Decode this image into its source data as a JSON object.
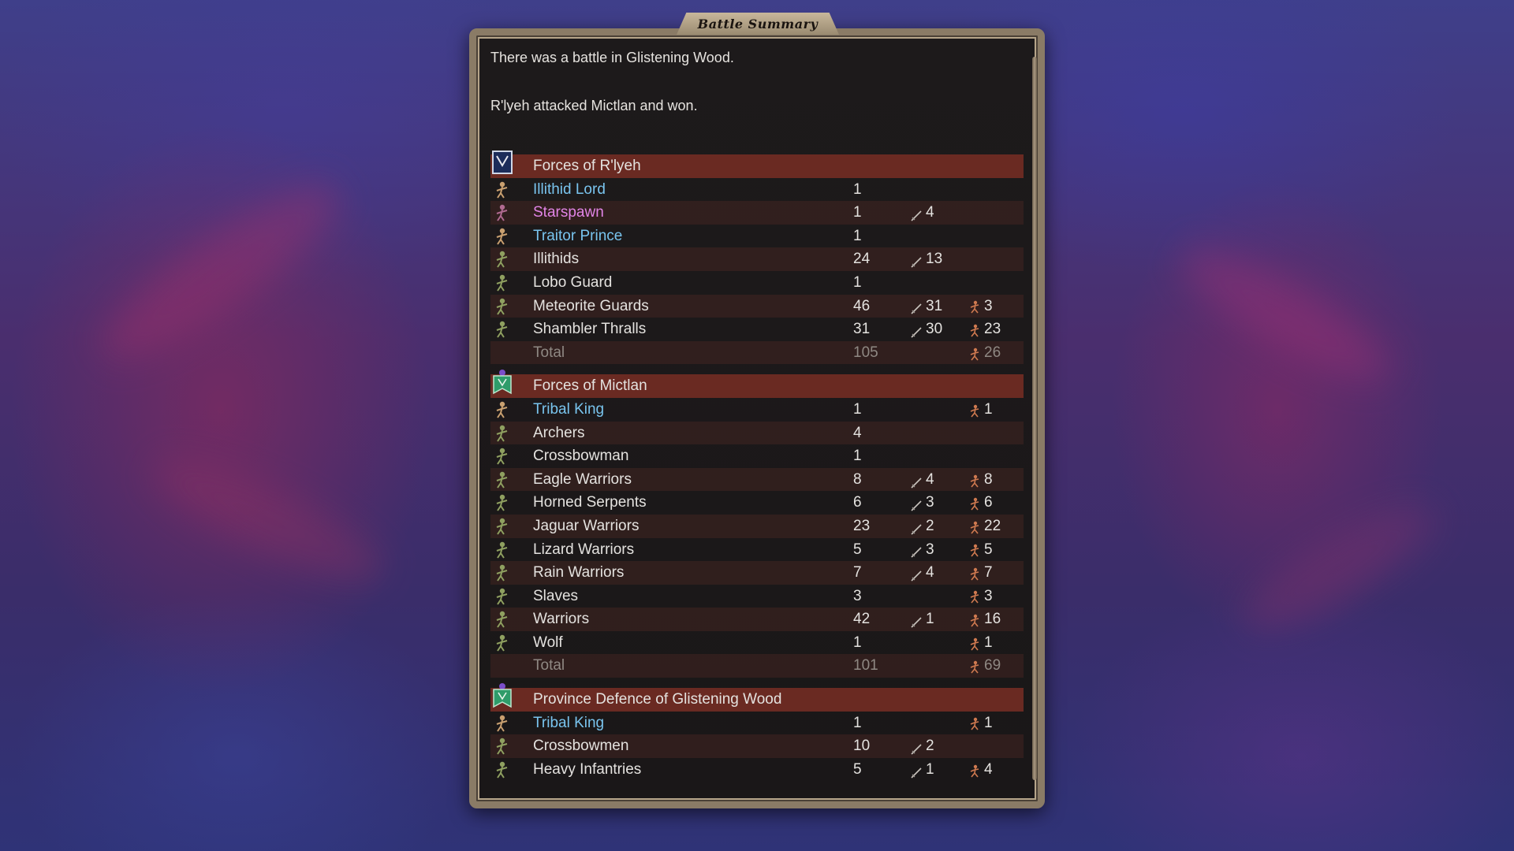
{
  "window": {
    "title": "Battle Summary"
  },
  "intro": {
    "line1": "There was a battle in Glistening Wood.",
    "line2": "R'lyeh attacked Mictlan and won."
  },
  "colors": {
    "commander": "#79c4ee",
    "magic_unit": "#e184e6",
    "header_bar": "#6a2a22",
    "alt_row": "#4b2823",
    "panel_frame": "#8a7b66"
  },
  "sections": [
    {
      "title": "Forces of R'lyeh",
      "banner_icon": "rlyeh-banner-icon",
      "rows": [
        {
          "name": "Illithid Lord",
          "type": "commander",
          "icon": "illithid-lord-icon",
          "count": "1",
          "kills": "",
          "losses": ""
        },
        {
          "name": "Starspawn",
          "type": "magic",
          "icon": "starspawn-icon",
          "count": "1",
          "kills": "4",
          "losses": ""
        },
        {
          "name": "Traitor Prince",
          "type": "commander",
          "icon": "traitor-prince-icon",
          "count": "1",
          "kills": "",
          "losses": ""
        },
        {
          "name": "Illithids",
          "type": "unit",
          "icon": "illithids-icon",
          "count": "24",
          "kills": "13",
          "losses": ""
        },
        {
          "name": "Lobo Guard",
          "type": "unit",
          "icon": "lobo-guard-icon",
          "count": "1",
          "kills": "",
          "losses": ""
        },
        {
          "name": "Meteorite Guards",
          "type": "unit",
          "icon": "meteorite-guards-icon",
          "count": "46",
          "kills": "31",
          "losses": "3"
        },
        {
          "name": "Shambler Thralls",
          "type": "unit",
          "icon": "shambler-thralls-icon",
          "count": "31",
          "kills": "30",
          "losses": "23"
        },
        {
          "name": "Total",
          "type": "total",
          "icon": "",
          "count": "105",
          "kills": "",
          "losses": "26"
        }
      ]
    },
    {
      "title": "Forces of Mictlan",
      "banner_icon": "mictlan-banner-icon",
      "rows": [
        {
          "name": "Tribal King",
          "type": "commander",
          "icon": "tribal-king-icon",
          "count": "1",
          "kills": "",
          "losses": "1"
        },
        {
          "name": "Archers",
          "type": "unit",
          "icon": "archers-icon",
          "count": "4",
          "kills": "",
          "losses": ""
        },
        {
          "name": "Crossbowman",
          "type": "unit",
          "icon": "crossbowman-icon",
          "count": "1",
          "kills": "",
          "losses": ""
        },
        {
          "name": "Eagle Warriors",
          "type": "unit",
          "icon": "eagle-warriors-icon",
          "count": "8",
          "kills": "4",
          "losses": "8"
        },
        {
          "name": "Horned Serpents",
          "type": "unit",
          "icon": "horned-serpents-icon",
          "count": "6",
          "kills": "3",
          "losses": "6"
        },
        {
          "name": "Jaguar Warriors",
          "type": "unit",
          "icon": "jaguar-warriors-icon",
          "count": "23",
          "kills": "2",
          "losses": "22"
        },
        {
          "name": "Lizard Warriors",
          "type": "unit",
          "icon": "lizard-warriors-icon",
          "count": "5",
          "kills": "3",
          "losses": "5"
        },
        {
          "name": "Rain Warriors",
          "type": "unit",
          "icon": "rain-warriors-icon",
          "count": "7",
          "kills": "4",
          "losses": "7"
        },
        {
          "name": "Slaves",
          "type": "unit",
          "icon": "slaves-icon",
          "count": "3",
          "kills": "",
          "losses": "3"
        },
        {
          "name": "Warriors",
          "type": "unit",
          "icon": "warriors-icon",
          "count": "42",
          "kills": "1",
          "losses": "16"
        },
        {
          "name": "Wolf",
          "type": "unit",
          "icon": "wolf-icon",
          "count": "1",
          "kills": "",
          "losses": "1"
        },
        {
          "name": "Total",
          "type": "total",
          "icon": "",
          "count": "101",
          "kills": "",
          "losses": "69"
        }
      ]
    },
    {
      "title": "Province Defence of Glistening Wood",
      "banner_icon": "province-defence-banner-icon",
      "rows": [
        {
          "name": "Tribal King",
          "type": "commander",
          "icon": "tribal-king-icon",
          "count": "1",
          "kills": "",
          "losses": "1"
        },
        {
          "name": "Crossbowmen",
          "type": "unit",
          "icon": "crossbowmen-icon",
          "count": "10",
          "kills": "2",
          "losses": ""
        },
        {
          "name": "Heavy Infantries",
          "type": "unit",
          "icon": "heavy-infantries-icon",
          "count": "5",
          "kills": "1",
          "losses": "4"
        }
      ]
    }
  ]
}
